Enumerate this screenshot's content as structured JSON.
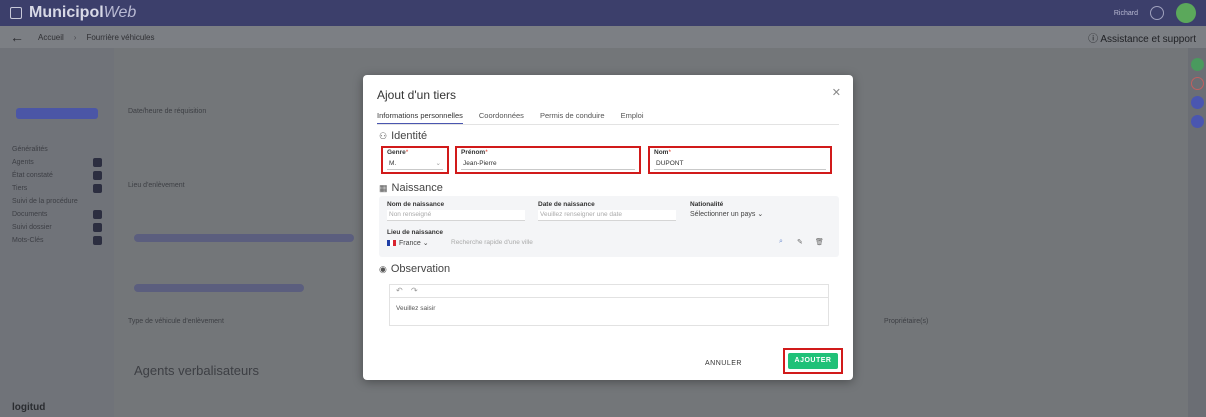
{
  "app": {
    "brand_main": "Municipol",
    "brand_accent": "Web",
    "user_label": "Richard"
  },
  "breadcrumb": {
    "home": "Accueil",
    "page": "Fourrière véhicules",
    "help": "Assistance et support"
  },
  "modal": {
    "title": "Ajout d'un tiers",
    "tabs": [
      "Informations personnelles",
      "Coordonnées",
      "Permis de conduire",
      "Emploi"
    ],
    "identity": {
      "title": "Identité",
      "genre_label": "Genre",
      "genre_value": "M.",
      "prenom_label": "Prénom",
      "prenom_value": "Jean-Pierre",
      "nom_label": "Nom",
      "nom_value": "DUPONT"
    },
    "birth": {
      "title": "Naissance",
      "birthname_label": "Nom de naissance",
      "birthname_placeholder": "Non renseigné",
      "birthdate_label": "Date de naissance",
      "birthdate_placeholder": "Veuillez renseigner une date",
      "nationality_label": "Nationalité",
      "nationality_placeholder": "Sélectionner un pays",
      "birthplace_label": "Lieu de naissance",
      "country_value": "France",
      "city_placeholder": "Recherche rapide d'une ville"
    },
    "observation": {
      "title": "Observation",
      "placeholder": "Veuillez saisir"
    },
    "cancel_label": "ANNULER",
    "add_label": "AJOUTER"
  },
  "background": {
    "sidebar_items": [
      "Généralités",
      "Agents",
      "État constaté",
      "Tiers",
      "Suivi de la procédure",
      "Documents",
      "Suivi dossier",
      "Mots-Clés"
    ],
    "section_agents": "Agents verbalisateurs",
    "date_label": "Date/heure de réquisition",
    "place_label": "Lieu d'enlèvement",
    "type_label": "Type de véhicule d'enlèvement",
    "owner_label": "Propriétaire(s)",
    "logo": "logitud"
  },
  "colors": {
    "accent": "#4a56b0",
    "add_button": "#1fc178",
    "highlight": "#d11a1a"
  }
}
